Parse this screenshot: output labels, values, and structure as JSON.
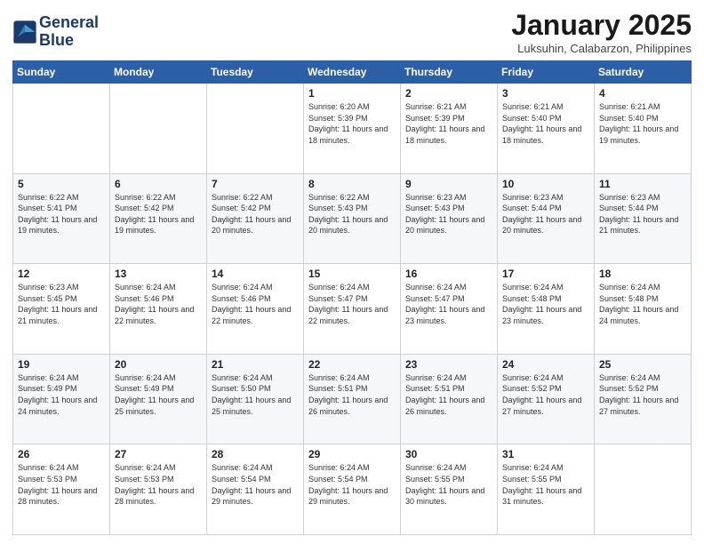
{
  "header": {
    "logo_line1": "General",
    "logo_line2": "Blue",
    "month_year": "January 2025",
    "location": "Luksuhin, Calabarzon, Philippines"
  },
  "days_of_week": [
    "Sunday",
    "Monday",
    "Tuesday",
    "Wednesday",
    "Thursday",
    "Friday",
    "Saturday"
  ],
  "weeks": [
    [
      {
        "day": "",
        "info": ""
      },
      {
        "day": "",
        "info": ""
      },
      {
        "day": "",
        "info": ""
      },
      {
        "day": "1",
        "info": "Sunrise: 6:20 AM\nSunset: 5:39 PM\nDaylight: 11 hours and 18 minutes."
      },
      {
        "day": "2",
        "info": "Sunrise: 6:21 AM\nSunset: 5:39 PM\nDaylight: 11 hours and 18 minutes."
      },
      {
        "day": "3",
        "info": "Sunrise: 6:21 AM\nSunset: 5:40 PM\nDaylight: 11 hours and 18 minutes."
      },
      {
        "day": "4",
        "info": "Sunrise: 6:21 AM\nSunset: 5:40 PM\nDaylight: 11 hours and 19 minutes."
      }
    ],
    [
      {
        "day": "5",
        "info": "Sunrise: 6:22 AM\nSunset: 5:41 PM\nDaylight: 11 hours and 19 minutes."
      },
      {
        "day": "6",
        "info": "Sunrise: 6:22 AM\nSunset: 5:42 PM\nDaylight: 11 hours and 19 minutes."
      },
      {
        "day": "7",
        "info": "Sunrise: 6:22 AM\nSunset: 5:42 PM\nDaylight: 11 hours and 20 minutes."
      },
      {
        "day": "8",
        "info": "Sunrise: 6:22 AM\nSunset: 5:43 PM\nDaylight: 11 hours and 20 minutes."
      },
      {
        "day": "9",
        "info": "Sunrise: 6:23 AM\nSunset: 5:43 PM\nDaylight: 11 hours and 20 minutes."
      },
      {
        "day": "10",
        "info": "Sunrise: 6:23 AM\nSunset: 5:44 PM\nDaylight: 11 hours and 20 minutes."
      },
      {
        "day": "11",
        "info": "Sunrise: 6:23 AM\nSunset: 5:44 PM\nDaylight: 11 hours and 21 minutes."
      }
    ],
    [
      {
        "day": "12",
        "info": "Sunrise: 6:23 AM\nSunset: 5:45 PM\nDaylight: 11 hours and 21 minutes."
      },
      {
        "day": "13",
        "info": "Sunrise: 6:24 AM\nSunset: 5:46 PM\nDaylight: 11 hours and 22 minutes."
      },
      {
        "day": "14",
        "info": "Sunrise: 6:24 AM\nSunset: 5:46 PM\nDaylight: 11 hours and 22 minutes."
      },
      {
        "day": "15",
        "info": "Sunrise: 6:24 AM\nSunset: 5:47 PM\nDaylight: 11 hours and 22 minutes."
      },
      {
        "day": "16",
        "info": "Sunrise: 6:24 AM\nSunset: 5:47 PM\nDaylight: 11 hours and 23 minutes."
      },
      {
        "day": "17",
        "info": "Sunrise: 6:24 AM\nSunset: 5:48 PM\nDaylight: 11 hours and 23 minutes."
      },
      {
        "day": "18",
        "info": "Sunrise: 6:24 AM\nSunset: 5:48 PM\nDaylight: 11 hours and 24 minutes."
      }
    ],
    [
      {
        "day": "19",
        "info": "Sunrise: 6:24 AM\nSunset: 5:49 PM\nDaylight: 11 hours and 24 minutes."
      },
      {
        "day": "20",
        "info": "Sunrise: 6:24 AM\nSunset: 5:49 PM\nDaylight: 11 hours and 25 minutes."
      },
      {
        "day": "21",
        "info": "Sunrise: 6:24 AM\nSunset: 5:50 PM\nDaylight: 11 hours and 25 minutes."
      },
      {
        "day": "22",
        "info": "Sunrise: 6:24 AM\nSunset: 5:51 PM\nDaylight: 11 hours and 26 minutes."
      },
      {
        "day": "23",
        "info": "Sunrise: 6:24 AM\nSunset: 5:51 PM\nDaylight: 11 hours and 26 minutes."
      },
      {
        "day": "24",
        "info": "Sunrise: 6:24 AM\nSunset: 5:52 PM\nDaylight: 11 hours and 27 minutes."
      },
      {
        "day": "25",
        "info": "Sunrise: 6:24 AM\nSunset: 5:52 PM\nDaylight: 11 hours and 27 minutes."
      }
    ],
    [
      {
        "day": "26",
        "info": "Sunrise: 6:24 AM\nSunset: 5:53 PM\nDaylight: 11 hours and 28 minutes."
      },
      {
        "day": "27",
        "info": "Sunrise: 6:24 AM\nSunset: 5:53 PM\nDaylight: 11 hours and 28 minutes."
      },
      {
        "day": "28",
        "info": "Sunrise: 6:24 AM\nSunset: 5:54 PM\nDaylight: 11 hours and 29 minutes."
      },
      {
        "day": "29",
        "info": "Sunrise: 6:24 AM\nSunset: 5:54 PM\nDaylight: 11 hours and 29 minutes."
      },
      {
        "day": "30",
        "info": "Sunrise: 6:24 AM\nSunset: 5:55 PM\nDaylight: 11 hours and 30 minutes."
      },
      {
        "day": "31",
        "info": "Sunrise: 6:24 AM\nSunset: 5:55 PM\nDaylight: 11 hours and 31 minutes."
      },
      {
        "day": "",
        "info": ""
      }
    ]
  ]
}
